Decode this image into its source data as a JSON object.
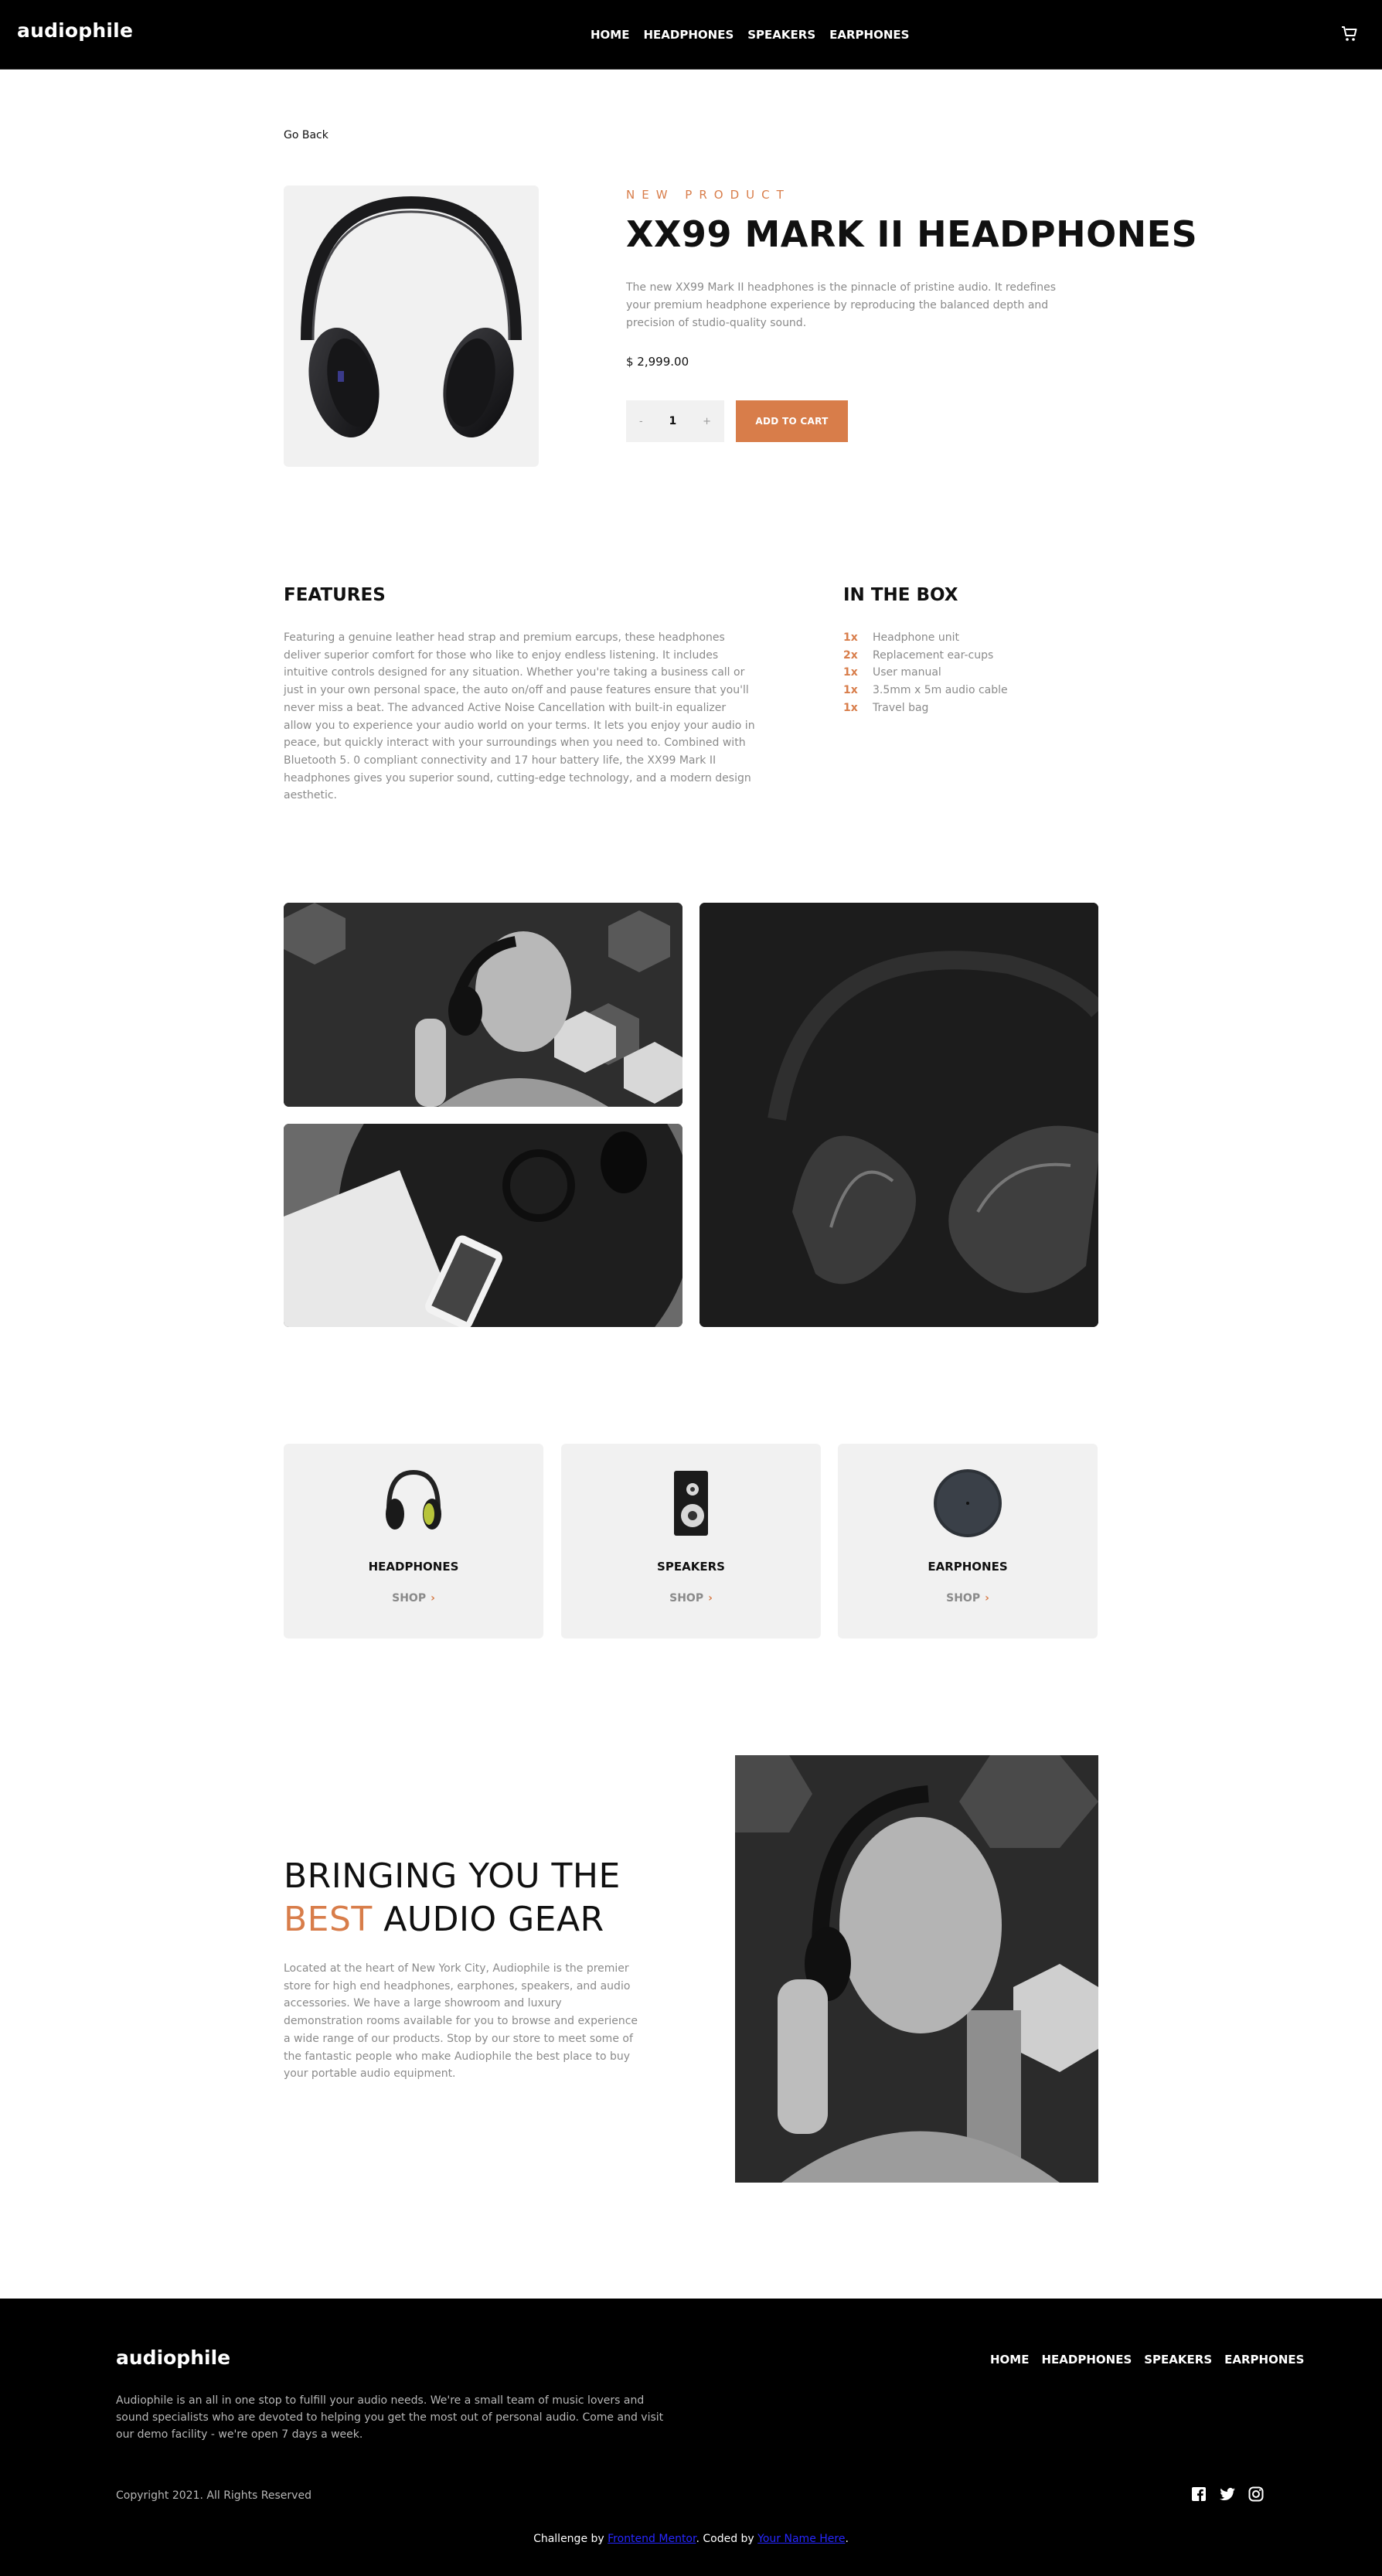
{
  "header": {
    "logo": "audiophile",
    "nav": [
      "HOME",
      "HEADPHONES",
      "SPEAKERS",
      "EARPHONES"
    ],
    "cart_icon": "cart-icon"
  },
  "product": {
    "go_back": "Go Back",
    "overline": "NEW PRODUCT",
    "title": "XX99 MARK II HEADPHONES",
    "description": "The new XX99 Mark II headphones is the pinnacle of pristine audio. It redefines your premium headphone experience by reproducing the balanced depth and precision of studio-quality sound.",
    "price": "$ 2,999.00",
    "quantity": {
      "minus": "-",
      "value": "1",
      "plus": "+"
    },
    "add_to_cart": "ADD TO CART"
  },
  "features": {
    "heading": "FEATURES",
    "text": "Featuring a genuine leather head strap and premium earcups, these headphones deliver superior comfort for those who like to enjoy endless listening. It includes intuitive controls designed for any situation. Whether you're taking a business call or just in your own personal space, the auto on/off and pause features ensure that you'll never miss a beat. The advanced Active Noise Cancellation with built-in equalizer allow you to experience your audio world on your terms. It lets you enjoy your audio in peace, but quickly interact with your surroundings when you need to. Combined with Bluetooth 5. 0 compliant connectivity and 17 hour battery life, the XX99 Mark II headphones gives you superior sound, cutting-edge technology, and a modern design aesthetic."
  },
  "in_the_box": {
    "heading": "IN THE BOX",
    "items": [
      {
        "qty": "1x",
        "label": "Headphone unit"
      },
      {
        "qty": "2x",
        "label": "Replacement ear-cups"
      },
      {
        "qty": "1x",
        "label": "User manual"
      },
      {
        "qty": "1x",
        "label": "3.5mm x 5m audio cable"
      },
      {
        "qty": "1x",
        "label": "Travel bag"
      }
    ]
  },
  "categories": [
    {
      "label": "HEADPHONES",
      "shop": "SHOP"
    },
    {
      "label": "SPEAKERS",
      "shop": "SHOP"
    },
    {
      "label": "EARPHONES",
      "shop": "SHOP"
    }
  ],
  "best_gear": {
    "line1": "BRINGING YOU THE",
    "accent": "BEST",
    "line2_rest": "AUDIO GEAR",
    "text": "Located at the heart of New York City, Audiophile is the premier store for high end headphones, earphones, speakers, and audio accessories. We have a large showroom and luxury demonstration rooms available for you to browse and experience a wide range of our products. Stop by our store to meet some of the fantastic people who make Audiophile the best place to buy your portable audio equipment."
  },
  "footer": {
    "logo": "audiophile",
    "nav": [
      "HOME",
      "HEADPHONES",
      "SPEAKERS",
      "EARPHONES"
    ],
    "description": "Audiophile is an all in one stop to fulfill your audio needs. We're a small team of music lovers and sound specialists who are devoted to helping you get the most out of personal audio. Come and visit our demo facility - we're open 7 days a week.",
    "copyright": "Copyright 2021. All Rights Reserved",
    "social": [
      "facebook-icon",
      "twitter-icon",
      "instagram-icon"
    ],
    "credit_prefix": "Challenge by ",
    "credit_link1": "Frontend Mentor",
    "credit_mid": ". Coded by ",
    "credit_link2": "Your Name Here",
    "credit_suffix": "."
  },
  "colors": {
    "accent": "#d87d4a",
    "dark": "#000000",
    "light_gray": "#f1f1f1"
  }
}
